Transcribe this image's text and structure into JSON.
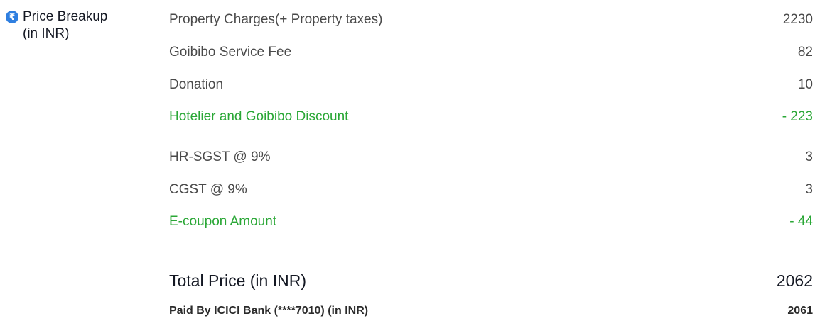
{
  "section": {
    "icon": "rupee-icon",
    "icon_glyph": "₹",
    "title_line1": "Price Breakup",
    "title_line2": "(in INR)"
  },
  "items": [
    {
      "label": "Property Charges(+ Property taxes)",
      "value": "2230"
    },
    {
      "label": "Goibibo Service Fee",
      "value": "82"
    },
    {
      "label": "Donation",
      "value": "10"
    },
    {
      "label": "Hotelier and Goibibo Discount",
      "value": "- 223"
    },
    {
      "label": "HR-SGST @ 9%",
      "value": "3"
    },
    {
      "label": "CGST @ 9%",
      "value": "3"
    },
    {
      "label": "E-coupon Amount",
      "value": "- 44"
    }
  ],
  "total": {
    "label": "Total Price (in INR)",
    "value": "2062"
  },
  "paid": {
    "label": "Paid By ICICI Bank (****7010) (in INR)",
    "value": "2061"
  },
  "colors": {
    "discount": "#2aa736",
    "icon_bg": "#2f7fe0",
    "divider": "#d6e4f0"
  }
}
